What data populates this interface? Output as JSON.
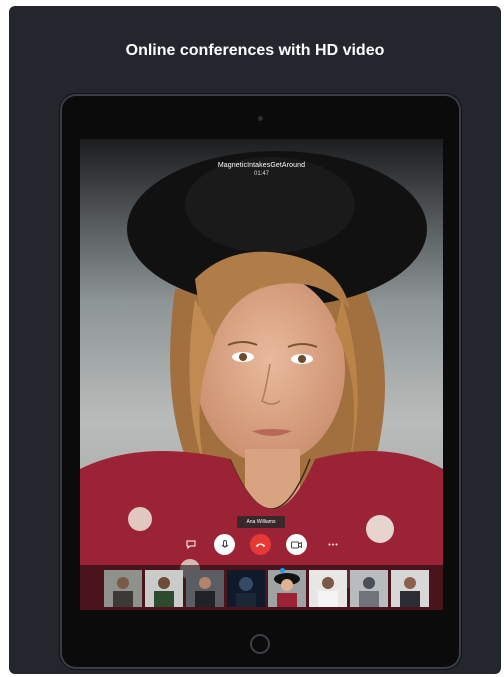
{
  "headline": "Online conferences with HD video",
  "call": {
    "title": "MagneticIntakesGetAround",
    "timer": "01:47",
    "participant_name": "Ana Williams"
  },
  "controls": [
    {
      "name": "chat",
      "icon": "chat-icon"
    },
    {
      "name": "microphone",
      "icon": "microphone-icon"
    },
    {
      "name": "end-call",
      "icon": "phone-hangup-icon"
    },
    {
      "name": "camera",
      "icon": "video-camera-icon"
    },
    {
      "name": "more",
      "icon": "more-dots-icon"
    }
  ],
  "colors": {
    "panel_bg": "#23262d",
    "end_call_red": "#e53935",
    "active_indicator": "#2196f3"
  },
  "participants_strip_count": 8
}
